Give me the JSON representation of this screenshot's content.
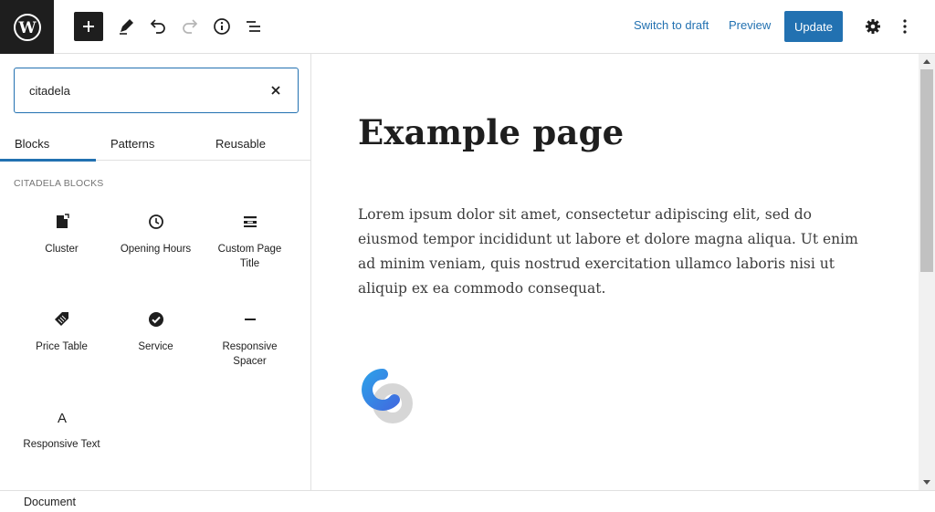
{
  "toolbar": {
    "switch_to_draft": "Switch to draft",
    "preview": "Preview",
    "update": "Update"
  },
  "inserter": {
    "search_value": "citadela",
    "tabs": [
      "Blocks",
      "Patterns",
      "Reusable"
    ],
    "active_tab": "Blocks",
    "section_title": "CITADELA BLOCKS",
    "blocks": [
      {
        "label": "Cluster",
        "icon": "cluster-icon"
      },
      {
        "label": "Opening Hours",
        "icon": "clock-icon"
      },
      {
        "label": "Custom Page Title",
        "icon": "page-title-icon"
      },
      {
        "label": "Price Table",
        "icon": "price-tag-icon"
      },
      {
        "label": "Service",
        "icon": "check-circle-icon"
      },
      {
        "label": "Responsive Spacer",
        "icon": "spacer-icon"
      },
      {
        "label": "Responsive Text",
        "icon": "text-a-icon"
      }
    ]
  },
  "editor": {
    "title": "Example page",
    "paragraph": "Lorem ipsum dolor sit amet, consectetur adipiscing elit, sed do eiusmod tempor incididunt ut labore et dolore magna aliqua. Ut enim ad minim veniam, quis nostrud exercitation ullamco laboris nisi ut aliquip ex ea commodo consequat."
  },
  "footer": {
    "breadcrumb": "Document"
  },
  "colors": {
    "accent": "#2271b1",
    "dark": "#1e1e1e"
  }
}
